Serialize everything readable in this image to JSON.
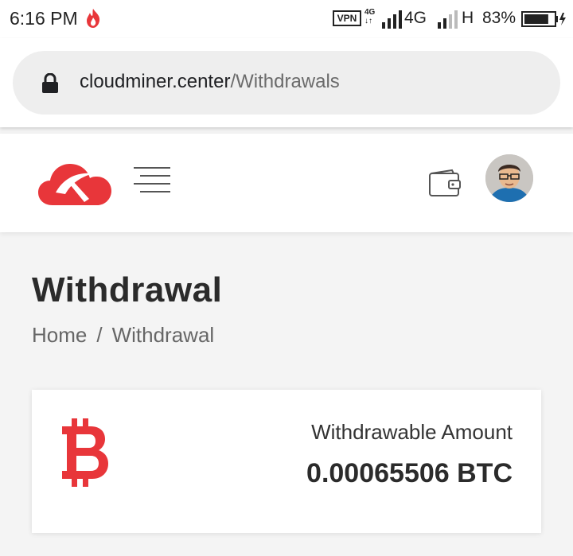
{
  "status_bar": {
    "time": "6:16 PM",
    "vpn": "VPN",
    "network_small": "4G",
    "network": "4G",
    "network_secondary": "H",
    "battery": "83%",
    "battery_level": 0.83
  },
  "browser": {
    "url_domain": "cloudminer.center",
    "url_path": "/Withdrawals"
  },
  "header": {
    "logo_icon": "cloud-pickaxe-logo",
    "menu_icon": "hamburger-menu-icon",
    "wallet_icon": "wallet-icon",
    "avatar_icon": "user-avatar"
  },
  "page": {
    "title": "Withdrawal",
    "breadcrumb": {
      "home": "Home",
      "separator": "/",
      "current": "Withdrawal"
    }
  },
  "card": {
    "icon": "bitcoin-icon",
    "label": "Withdrawable Amount",
    "amount": "0.00065506 BTC"
  },
  "colors": {
    "brand_red": "#e8363a",
    "text_dark": "#2b2b2b",
    "text_muted": "#666666"
  }
}
